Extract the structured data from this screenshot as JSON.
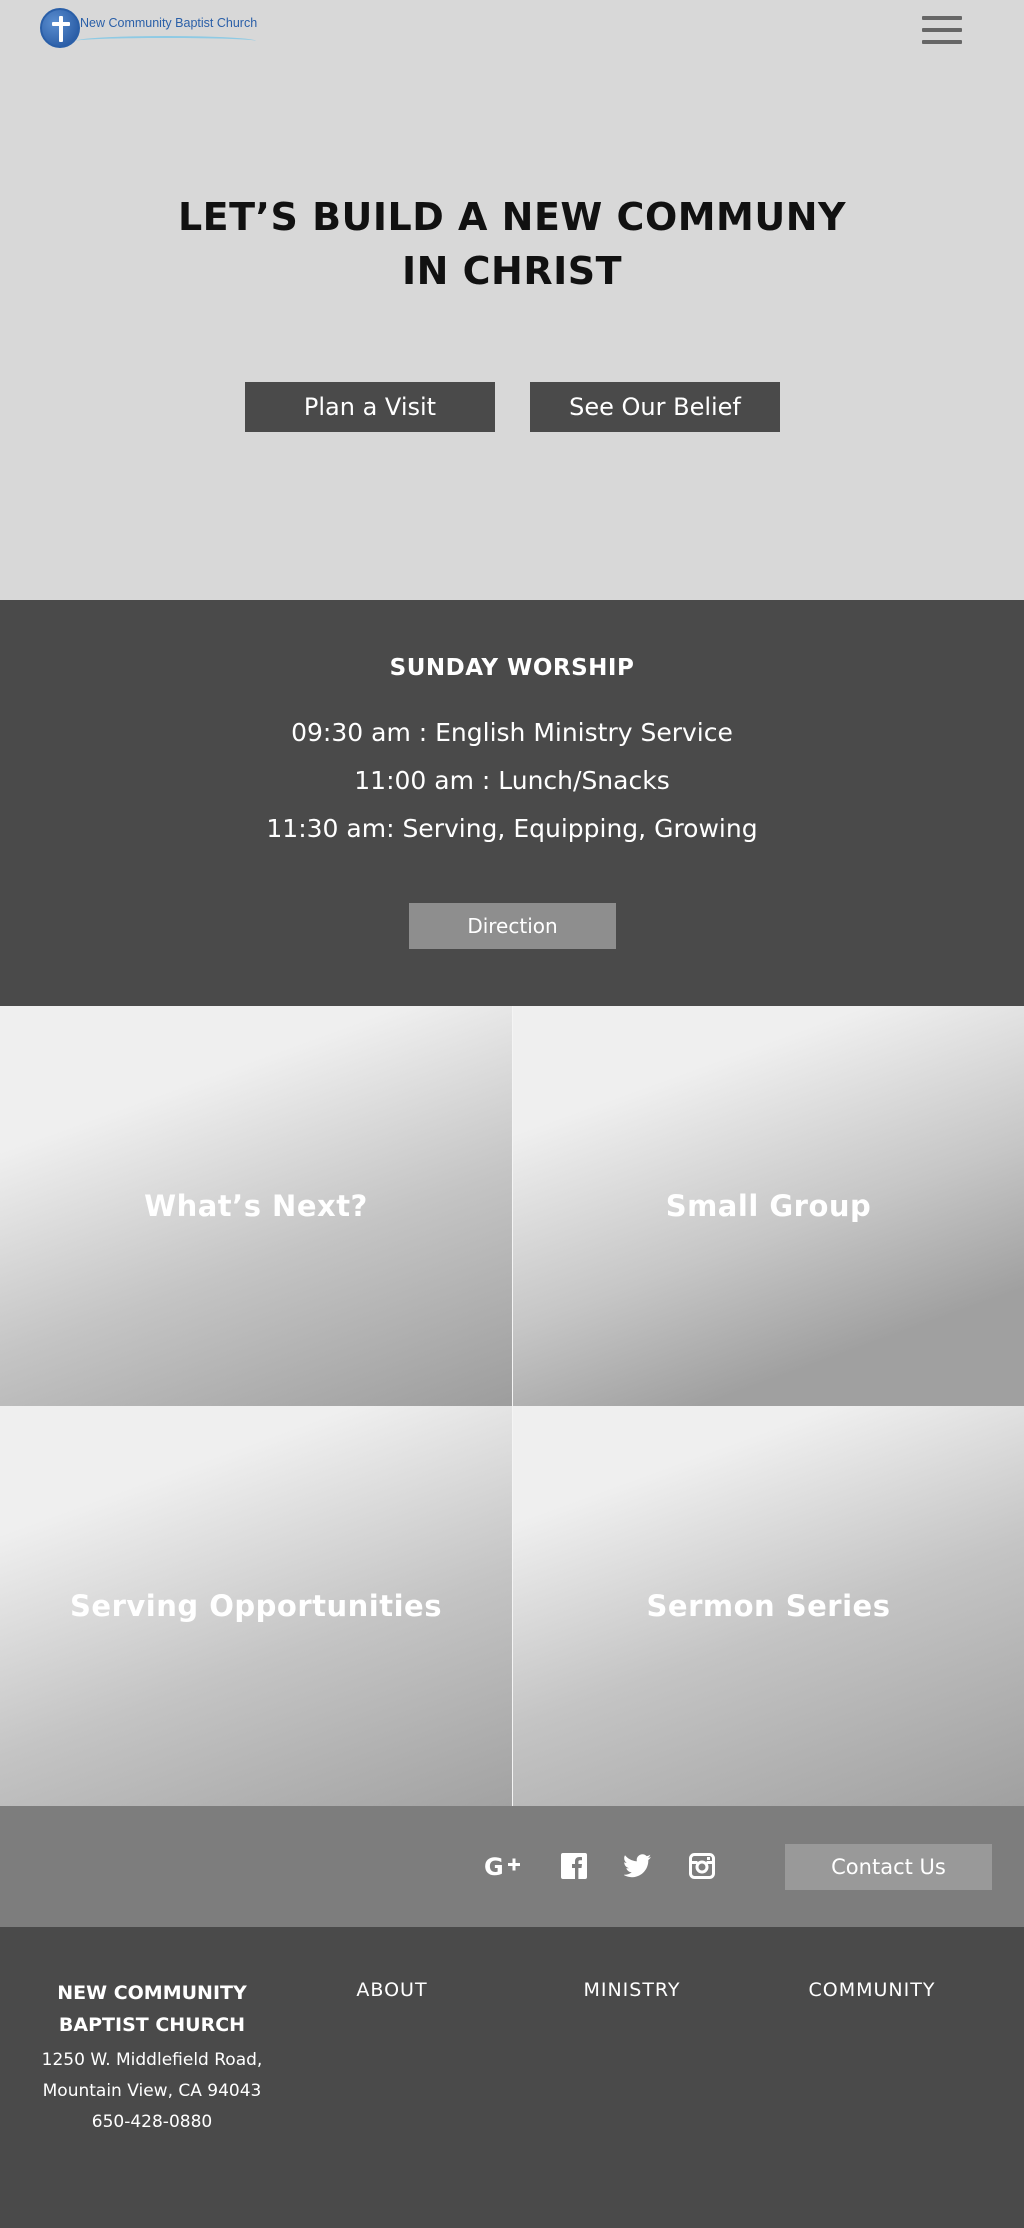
{
  "header": {
    "logo_text": "New Community Baptist Church",
    "menu_icon": "hamburger-menu-icon"
  },
  "hero": {
    "title_line1": "LET’S BUILD A NEW COMMUNY",
    "title_line2": "IN CHRIST",
    "plan_visit_label": "Plan a Visit",
    "see_belief_label": "See Our Belief"
  },
  "worship": {
    "title": "SUNDAY WORSHIP",
    "lines": [
      "09:30 am : English Ministry Service",
      "11:00 am : Lunch/Snacks",
      "11:30 am: Serving, Equipping, Growing"
    ],
    "direction_label": "Direction"
  },
  "tiles": [
    {
      "label": "What’s Next?"
    },
    {
      "label": "Small Group"
    },
    {
      "label": "Serving Opportunities"
    },
    {
      "label": "Sermon Series"
    }
  ],
  "social": {
    "icons": [
      "google-plus-icon",
      "facebook-icon",
      "twitter-icon",
      "instagram-icon"
    ],
    "contact_label": "Contact Us"
  },
  "footer": {
    "org_name_line1": "NEW COMMUNITY",
    "org_name_line2": "BAPTIST CHURCH",
    "address_line1": "1250 W. Middlefield Road,",
    "address_line2": "Mountain View, CA 94043",
    "phone": "650-428-0880",
    "links": [
      "ABOUT",
      "MINISTRY",
      "COMMUNITY"
    ]
  },
  "colors": {
    "hero_bg": "#d8d8d8",
    "dark_section": "#4a4a4a",
    "social_bar": "#7d7d7d",
    "button_dark": "#4a4a4a",
    "button_light": "#8e8e8e",
    "logo_blue": "#2a5fa8"
  }
}
